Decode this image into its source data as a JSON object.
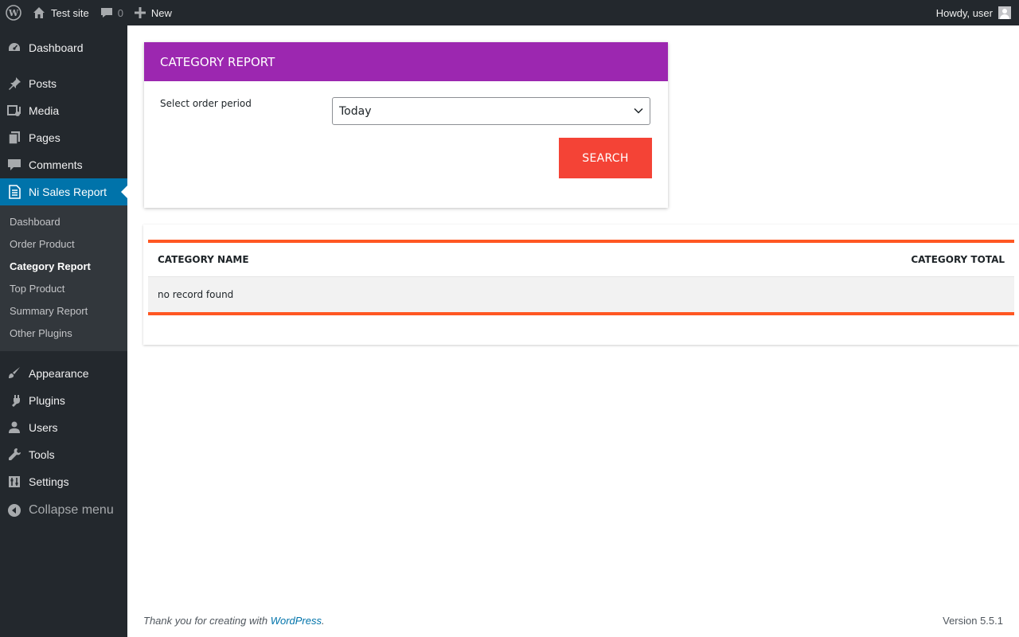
{
  "adminbar": {
    "site_name": "Test site",
    "comments_count": "0",
    "new_label": "New",
    "howdy": "Howdy, user"
  },
  "sidebar": {
    "items_top": [
      {
        "label": "Dashboard",
        "icon": "dashboard-icon"
      },
      {
        "label": "Posts",
        "icon": "pin-icon"
      },
      {
        "label": "Media",
        "icon": "media-icon"
      },
      {
        "label": "Pages",
        "icon": "pages-icon"
      },
      {
        "label": "Comments",
        "icon": "comment-icon"
      },
      {
        "label": "Ni Sales Report",
        "icon": "report-icon"
      }
    ],
    "submenu": [
      "Dashboard",
      "Order Product",
      "Category Report",
      "Top Product",
      "Summary Report",
      "Other Plugins"
    ],
    "items_bottom": [
      {
        "label": "Appearance",
        "icon": "brush-icon"
      },
      {
        "label": "Plugins",
        "icon": "plugin-icon"
      },
      {
        "label": "Users",
        "icon": "user-icon"
      },
      {
        "label": "Tools",
        "icon": "wrench-icon"
      },
      {
        "label": "Settings",
        "icon": "settings-icon"
      }
    ],
    "collapse": "Collapse menu"
  },
  "panel": {
    "title": "CATEGORY REPORT",
    "period_label": "Select order period",
    "period_value": "Today",
    "search_label": "SEARCH"
  },
  "table": {
    "col_name": "CATEGORY NAME",
    "col_total": "CATEGORY TOTAL",
    "empty": "no record found"
  },
  "footer": {
    "thanks": "Thank you for creating with ",
    "link": "WordPress",
    "period": ".",
    "version": "Version 5.5.1"
  },
  "colors": {
    "header_purple": "#9c27b0",
    "search_red": "#f44336",
    "table_orange": "#ff5722",
    "menu_active": "#0073aa"
  }
}
